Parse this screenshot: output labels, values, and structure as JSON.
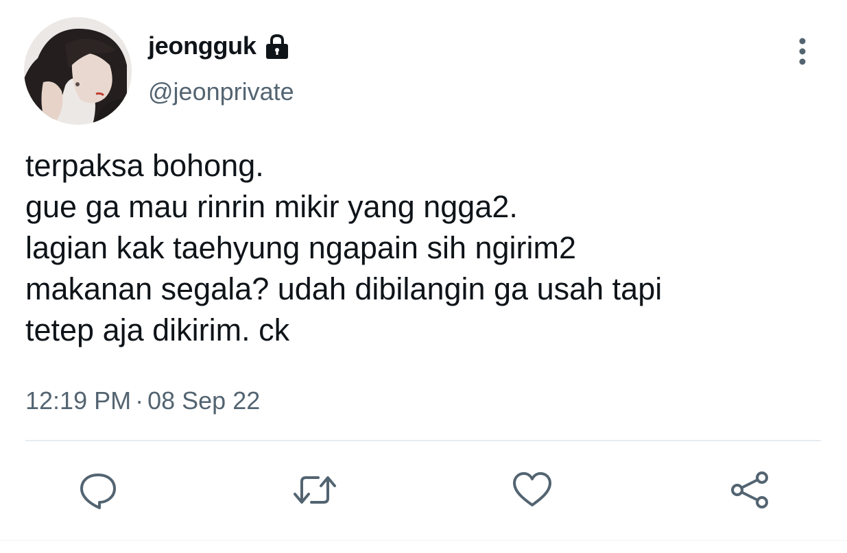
{
  "user": {
    "display_name": "jeongguk",
    "handle": "@jeonprivate",
    "protected_icon": "lock-icon",
    "avatar_icon": "avatar"
  },
  "tweet": {
    "lines": [
      "terpaksa bohong.",
      "gue ga mau rinrin mikir yang ngga2.",
      "lagian kak taehyung ngapain sih ngirim2",
      "makanan segala? udah dibilangin ga usah tapi",
      "tetep aja dikirim. ck"
    ],
    "time": "12:19 PM",
    "separator": "·",
    "date": "08 Sep 22"
  },
  "actions": [
    {
      "name": "reply",
      "icon": "reply-icon"
    },
    {
      "name": "retweet",
      "icon": "retweet-icon"
    },
    {
      "name": "like",
      "icon": "heart-icon"
    },
    {
      "name": "share",
      "icon": "share-icon"
    }
  ],
  "colors": {
    "text_primary": "#0f1419",
    "text_secondary": "#536471",
    "icon": "#536471",
    "divider": "#e6ecf0"
  }
}
